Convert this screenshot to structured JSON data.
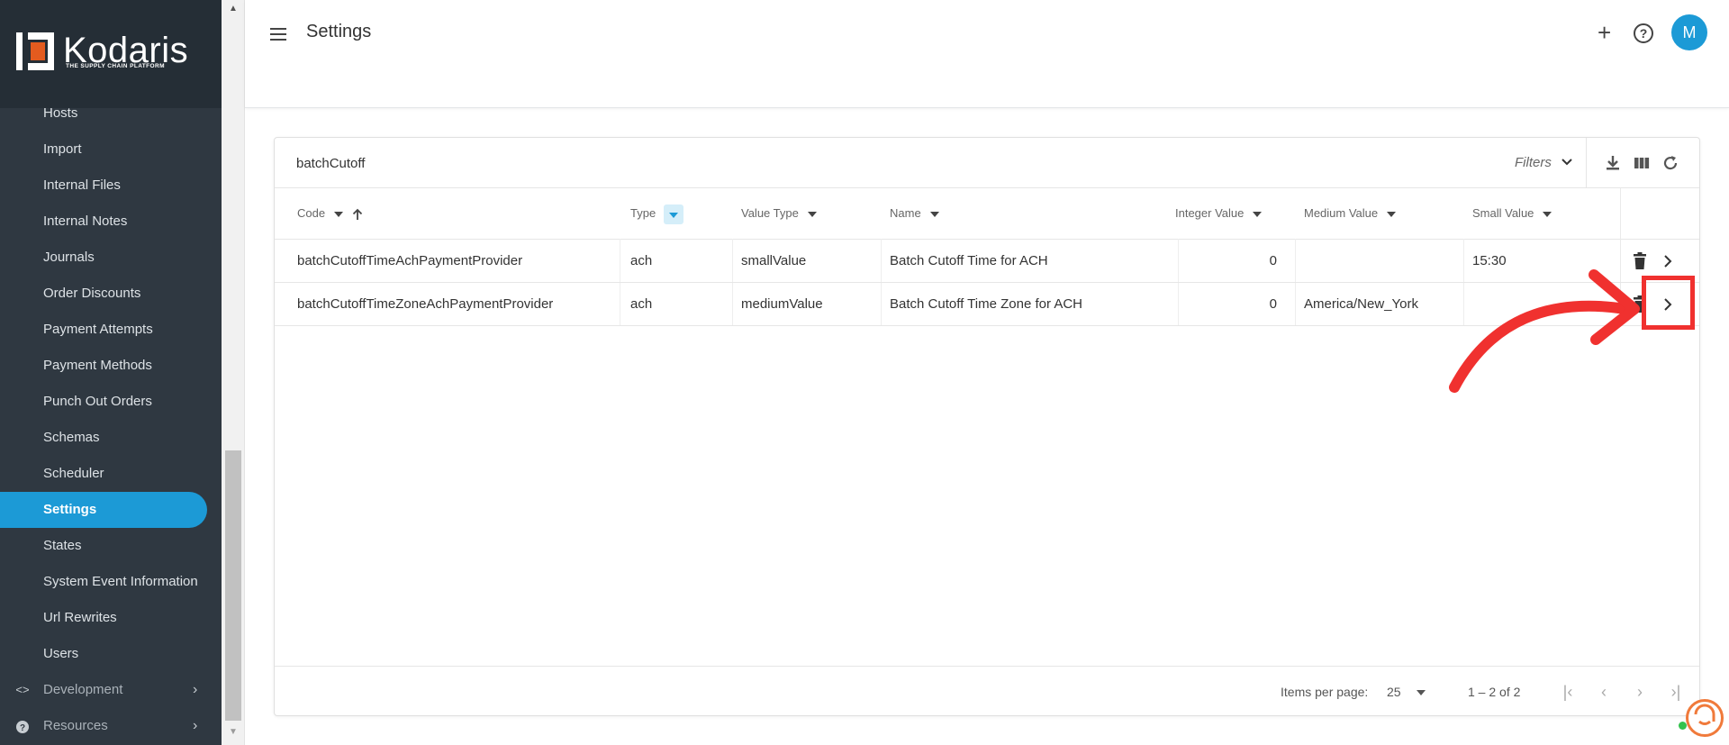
{
  "brand": {
    "name": "Kodaris",
    "tagline": "THE SUPPLY CHAIN PLATFORM",
    "accent": "#1c9ad6",
    "logo_color": "#e35b1f"
  },
  "sidebar": {
    "items": [
      {
        "label": "Hosts",
        "active": false
      },
      {
        "label": "Import",
        "active": false
      },
      {
        "label": "Internal Files",
        "active": false
      },
      {
        "label": "Internal Notes",
        "active": false
      },
      {
        "label": "Journals",
        "active": false
      },
      {
        "label": "Order Discounts",
        "active": false
      },
      {
        "label": "Payment Attempts",
        "active": false
      },
      {
        "label": "Payment Methods",
        "active": false
      },
      {
        "label": "Punch Out Orders",
        "active": false
      },
      {
        "label": "Schemas",
        "active": false
      },
      {
        "label": "Scheduler",
        "active": false
      },
      {
        "label": "Settings",
        "active": true
      },
      {
        "label": "States",
        "active": false
      },
      {
        "label": "System Event Information",
        "active": false
      },
      {
        "label": "Url Rewrites",
        "active": false
      },
      {
        "label": "Users",
        "active": false
      }
    ],
    "groups": [
      {
        "label": "Development",
        "icon": "code-icon"
      },
      {
        "label": "Resources",
        "icon": "help-circle-icon"
      }
    ]
  },
  "header": {
    "title": "Settings",
    "avatar_initial": "M"
  },
  "toolbar": {
    "search_value": "batchCutoff",
    "filters_label": "Filters",
    "icons": [
      "download-icon",
      "columns-icon",
      "refresh-icon"
    ]
  },
  "table": {
    "columns": [
      "Code",
      "Type",
      "Value Type",
      "Name",
      "Integer Value",
      "Medium Value",
      "Small Value"
    ],
    "rows": [
      {
        "code": "batchCutoffTimeAchPaymentProvider",
        "type": "ach",
        "value_type": "smallValue",
        "name": "Batch Cutoff Time for ACH",
        "integer_value": "0",
        "medium_value": "",
        "small_value": "15:30"
      },
      {
        "code": "batchCutoffTimeZoneAchPaymentProvider",
        "type": "ach",
        "value_type": "mediumValue",
        "name": "Batch Cutoff Time Zone for ACH",
        "integer_value": "0",
        "medium_value": "America/New_York",
        "small_value": ""
      }
    ]
  },
  "paginator": {
    "items_per_page_label": "Items per page:",
    "items_per_page": "25",
    "range": "1 – 2 of 2"
  },
  "annotation_color": "#f0312f"
}
